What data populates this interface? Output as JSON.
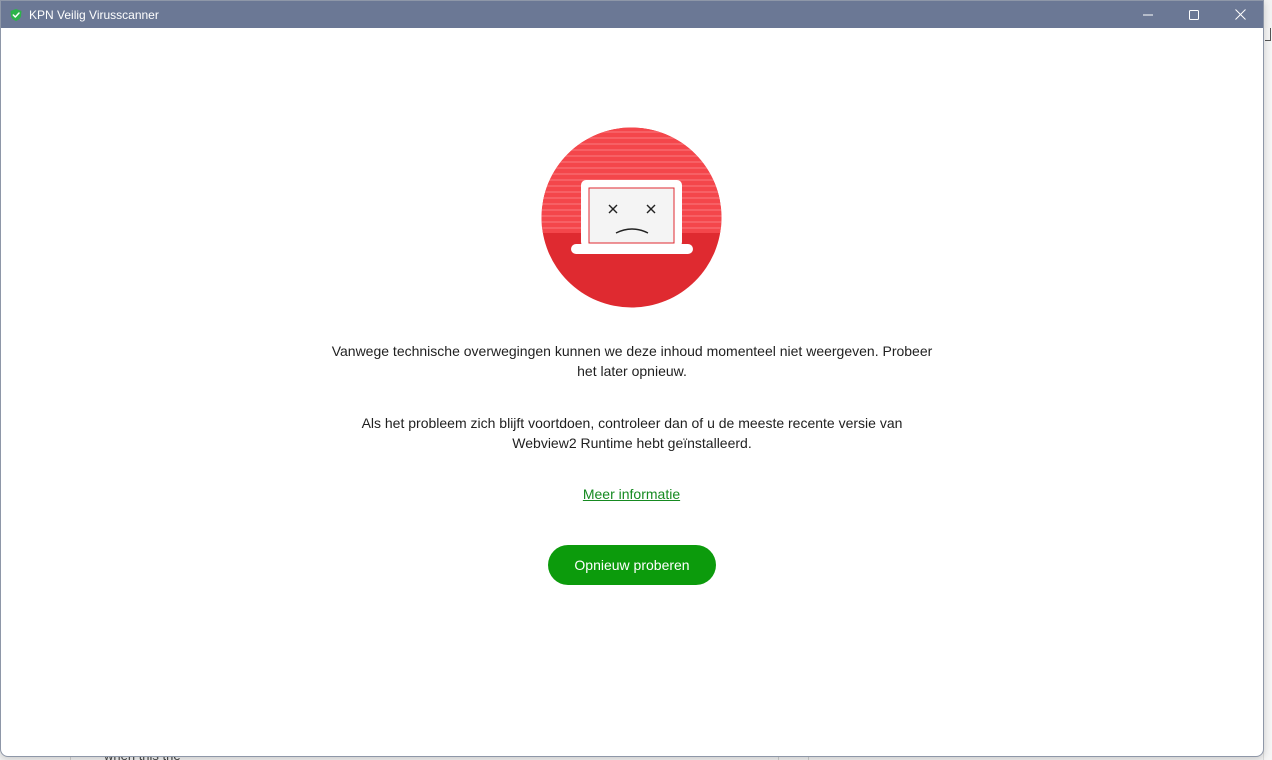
{
  "window": {
    "title": "KPN Veilig Virusscanner",
    "icon": "kpn-shield-icon"
  },
  "controls": {
    "minimize": "minimize-icon",
    "maximize": "maximize-icon",
    "close": "close-icon"
  },
  "error": {
    "illustration": "sad-laptop-icon",
    "message_1": "Vanwege technische overwegingen kunnen we deze inhoud momenteel niet weergeven. Probeer het later opnieuw.",
    "message_2": "Als het probleem zich blijft voortdoen, controleer dan of u de meeste recente versie van Webview2 Runtime hebt geïnstalleerd.",
    "link_label": "Meer informatie",
    "retry_label": "Opnieuw proberen"
  },
  "background": {
    "partial_text": "when this the"
  },
  "colors": {
    "titlebar": "#6b7895",
    "accent_green": "#0c9b0c",
    "link_green": "#168a21",
    "illustration_red": "#e12d33",
    "illustration_light_red": "#f24a4f"
  }
}
